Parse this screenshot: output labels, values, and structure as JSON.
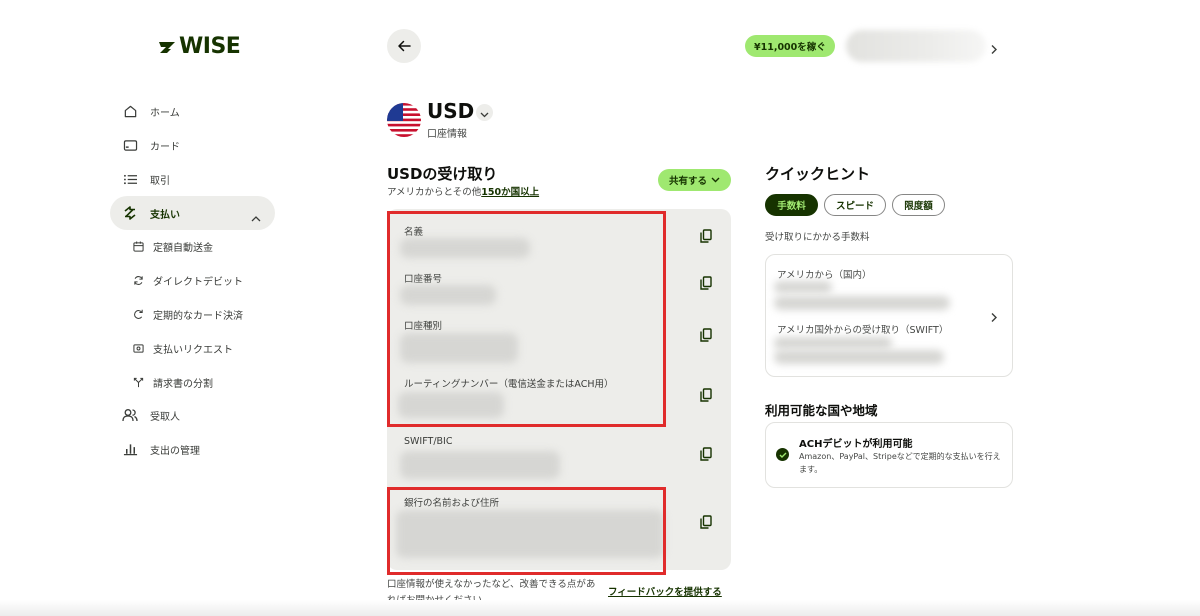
{
  "brand": {
    "logo_text": "WISE",
    "primary": "#163300",
    "accent": "#9fe870",
    "highlight_box": "#e02b2b"
  },
  "sidebar": {
    "items": [
      {
        "label": "ホーム",
        "icon": "home-icon"
      },
      {
        "label": "カード",
        "icon": "card-icon"
      },
      {
        "label": "取引",
        "icon": "list-icon"
      },
      {
        "label": "支払い",
        "icon": "payments-icon",
        "active": true,
        "expanded": true
      },
      {
        "label": "受取人",
        "icon": "recipients-icon"
      },
      {
        "label": "支出の管理",
        "icon": "bar-chart-icon"
      }
    ],
    "subitems": [
      {
        "label": "定額自動送金",
        "icon": "calendar-icon"
      },
      {
        "label": "ダイレクトデビット",
        "icon": "refresh-icon"
      },
      {
        "label": "定期的なカード決済",
        "icon": "rotate-icon"
      },
      {
        "label": "支払いリクエスト",
        "icon": "request-icon"
      },
      {
        "label": "請求書の分割",
        "icon": "split-icon"
      }
    ]
  },
  "header": {
    "earn_badge": "¥11,000を稼ぐ"
  },
  "currency": {
    "code": "USD",
    "subtitle": "口座情報"
  },
  "receive": {
    "title": "USDの受け取り",
    "subtitle_prefix": "アメリカからとその他",
    "subtitle_link": "150か国以上",
    "share_label": "共有する",
    "fields": [
      {
        "label": "名義"
      },
      {
        "label": "口座番号"
      },
      {
        "label": "口座種別"
      },
      {
        "label": "ルーティングナンバー（電信送金またはACH用）"
      },
      {
        "label": "SWIFT/BIC"
      },
      {
        "label": "銀行の名前および住所"
      }
    ]
  },
  "feedback": {
    "text": "口座情報が使えなかったなど、改善できる点があればお聞かせください。",
    "link": "フィードバックを提供する"
  },
  "hints": {
    "title": "クイックヒント",
    "tabs": [
      {
        "label": "手数料",
        "active": true
      },
      {
        "label": "スピード",
        "active": false
      },
      {
        "label": "限度額",
        "active": false
      }
    ],
    "description": "受け取りにかかる手数料",
    "fee_domestic": "アメリカから（国内）",
    "fee_swift": "アメリカ国外からの受け取り（SWIFT）"
  },
  "regions": {
    "title": "利用可能な国や地域",
    "ach_title": "ACHデビットが利用可能",
    "ach_desc": "Amazon、PayPal、Stripeなどで定期的な支払いを行えます。"
  }
}
